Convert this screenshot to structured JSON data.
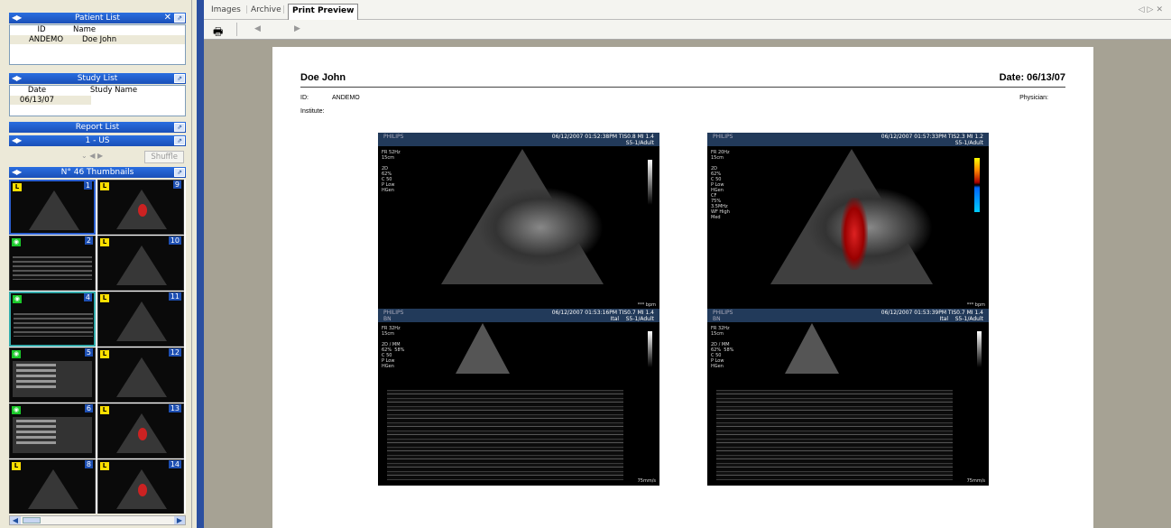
{
  "patient_list": {
    "title": "Patient List",
    "columns": [
      "ID",
      "Name"
    ],
    "rows": [
      {
        "id": "ANDEMO",
        "name": "Doe John"
      }
    ]
  },
  "study_list": {
    "title": "Study List",
    "columns": [
      "Date",
      "Study Name"
    ],
    "rows": [
      {
        "date": "06/13/07",
        "name": ""
      }
    ]
  },
  "report_list": {
    "title": "Report List"
  },
  "us_list": {
    "title": "1 - US",
    "shuffle_label": "Shuffle"
  },
  "thumbnails": {
    "title": "N° 46 Thumbnails",
    "items": [
      {
        "num": "1",
        "badge": "L",
        "kind": "echo"
      },
      {
        "num": "9",
        "badge": "L",
        "kind": "color"
      },
      {
        "num": "2",
        "badge": "eye",
        "kind": "mmode"
      },
      {
        "num": "10",
        "badge": "L",
        "kind": "echo"
      },
      {
        "num": "4",
        "badge": "eye",
        "kind": "mmode"
      },
      {
        "num": "11",
        "badge": "L",
        "kind": "echo"
      },
      {
        "num": "5",
        "badge": "eye",
        "kind": "doc"
      },
      {
        "num": "12",
        "badge": "L",
        "kind": "echo"
      },
      {
        "num": "6",
        "badge": "eye",
        "kind": "doc"
      },
      {
        "num": "13",
        "badge": "L",
        "kind": "color"
      },
      {
        "num": "8",
        "badge": "L",
        "kind": "echo"
      },
      {
        "num": "14",
        "badge": "L",
        "kind": "color"
      }
    ]
  },
  "tabs": [
    "Images",
    "Archive",
    "Print Preview"
  ],
  "active_tab": "Print Preview",
  "report": {
    "patient_name": "Doe John",
    "date_label": "Date: 06/13/07",
    "id_label": "ID:",
    "id_value": "ANDEMO",
    "institute_label": "Institute:",
    "physician_label": "Physician:"
  },
  "images": [
    {
      "brand": "PHILIPS",
      "stamp": "06/12/2007  01:52:38PM  TIS0.8  MI 1.4",
      "probe": "S5-1/Adult",
      "params": "FR 52Hz\n15cm\n\n2D\n62%\nC 50\nP Low\nHGen",
      "bpm": "*** bpm",
      "mode": "echo"
    },
    {
      "brand": "PHILIPS",
      "stamp": "06/12/2007  01:57:33PM  TIS2.3  MI 1.2",
      "probe": "S5-1/Adult",
      "params": "FR 20Hz\n15cm\n\n2D\n62%\nC 50\nP Low\nHGen\nCF\n75%\n3.5MHz\nWF High\nMed",
      "bpm": "*** bpm",
      "mode": "color"
    },
    {
      "brand": "PHILIPS",
      "sub": "BN",
      "stamp": "06/12/2007  01:53:16PM  TIS0.7  MI 1.4",
      "probe": "S5-1/Adult",
      "probe_prefix": "Ital",
      "params": "FR 32Hz\n15cm\n\n2D / MM\n62%  58%\nC 50\nP Low\nHGen",
      "speed": "75mm/s",
      "mode": "mmode"
    },
    {
      "brand": "PHILIPS",
      "sub": "BN",
      "stamp": "06/12/2007  01:53:39PM  TIS0.7  MI 1.4",
      "probe": "S5-1/Adult",
      "probe_prefix": "Ital",
      "params": "FR 32Hz\n15cm\n\n2D / MM\n62%  58%\nC 50\nP Low\nHGen",
      "speed": "75mm/s",
      "mode": "mmode"
    }
  ]
}
